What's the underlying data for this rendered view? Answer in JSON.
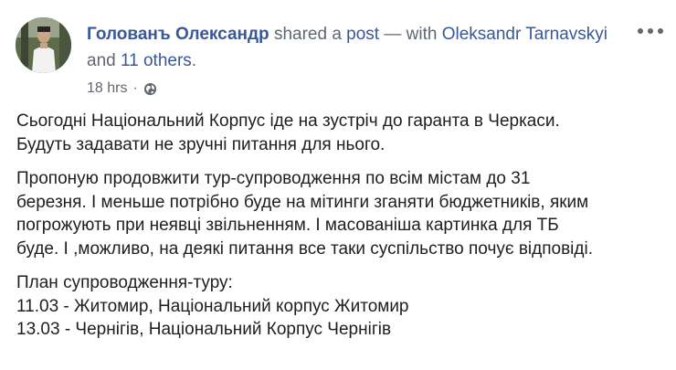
{
  "post": {
    "author": "Голованъ Олександр",
    "shared_text": " shared a ",
    "post_link": "post",
    "with_text": " — with ",
    "tagged_user": "Oleksandr Tarnavskyi",
    "and_text": " and ",
    "others_link": "11 others",
    "period": ".",
    "timestamp": "18 hrs",
    "separator": "·",
    "privacy_icon": "globe-icon",
    "options_icon": "more-options-icon",
    "paragraphs": [
      {
        "lines": [
          "Сьогодні Національний Корпус іде на зустріч до гаранта в Черкаси.",
          "Будуть задавати не зручні питання для нього."
        ]
      },
      {
        "lines": [
          "Пропоную продовжити тур-супроводження по всім містам до 31",
          "березня. І меньше потрібно буде на мітинги зганяти бюджетників, яким",
          "погрожують при неявці звільненням. І масованіша картинка для ТБ",
          "буде. І ,можливо, на деякі питання все таки суспільство почує відповіді."
        ]
      },
      {
        "lines": [
          "План супроводження-туру:",
          "11.03 - Житомир, Національний корпус Житомир",
          "13.03 - Чернігів, Національний Корпус Чернігів"
        ]
      }
    ]
  }
}
